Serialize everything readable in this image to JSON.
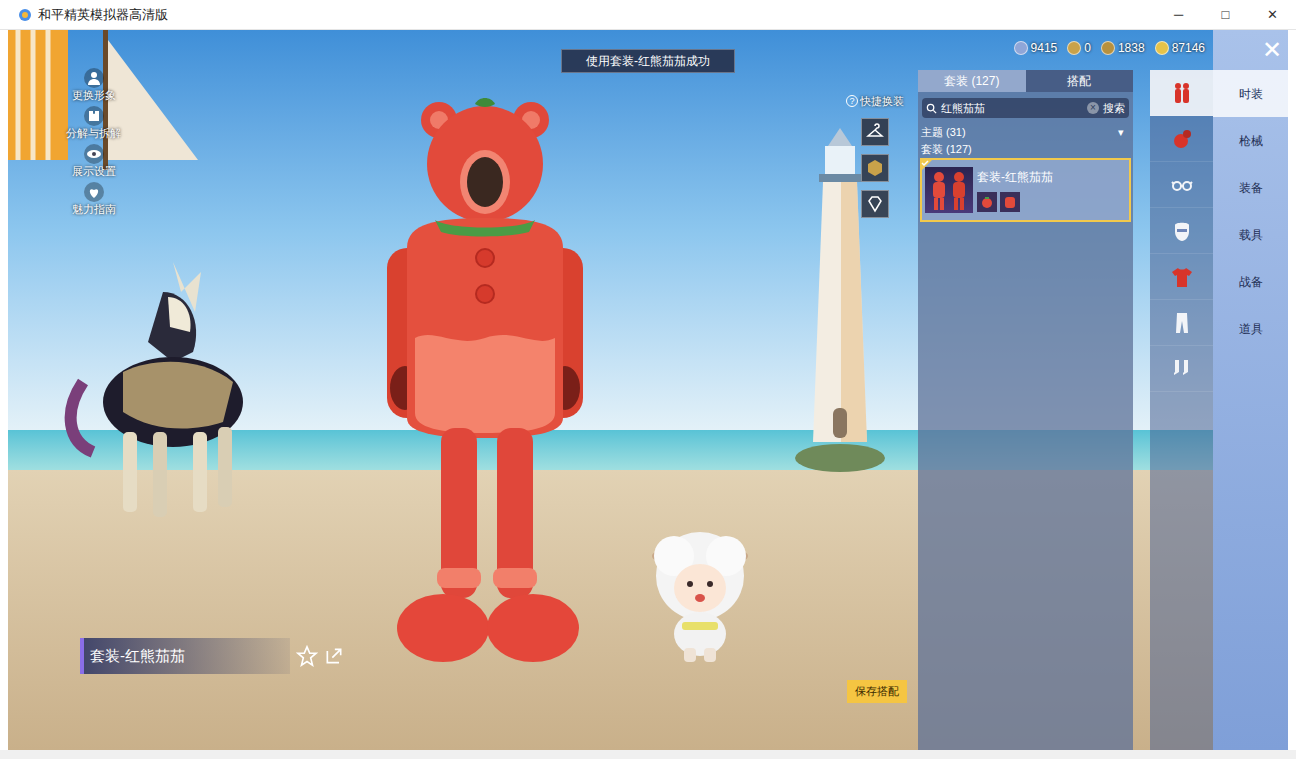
{
  "window": {
    "title": "和平精英模拟器高清版",
    "controls": [
      "─",
      "□",
      "✕"
    ]
  },
  "toast": "使用套装-红熊茄茄成功",
  "currencies": [
    {
      "value": "9415",
      "color": "#8fa6d8"
    },
    {
      "value": "0",
      "color": "#c9a24a"
    },
    {
      "value": "1838",
      "color": "#b8913e"
    },
    {
      "value": "87146",
      "color": "#e6c34a"
    }
  ],
  "close_button": "✕",
  "side_menu": [
    {
      "label": "更换形象"
    },
    {
      "label": "分解与拆解"
    },
    {
      "label": "展示设置"
    },
    {
      "label": "魅力指南"
    }
  ],
  "quick_change": {
    "label": "快捷换装",
    "help": "?"
  },
  "outfit_name": "套装-红熊茄茄",
  "save_button": "保存搭配",
  "panel": {
    "tabs": [
      {
        "label": "套装 (127)",
        "selected": true
      },
      {
        "label": "搭配",
        "selected": false
      }
    ],
    "search": {
      "value": "红熊茄茄",
      "clear": "×",
      "button": "搜索"
    },
    "filter": {
      "label": "主题 (31)",
      "arrow": "▾"
    },
    "section": "套装 (127)",
    "items": [
      {
        "name": "套装-红熊茄茄",
        "selected": true
      }
    ]
  },
  "categories": [
    {
      "selected": true
    },
    {
      "selected": false
    },
    {
      "selected": false
    },
    {
      "selected": false
    },
    {
      "selected": false
    },
    {
      "selected": false
    },
    {
      "selected": false
    }
  ],
  "nav": [
    {
      "label": "时装",
      "selected": true
    },
    {
      "label": "枪械",
      "selected": false
    },
    {
      "label": "装备",
      "selected": false
    },
    {
      "label": "载具",
      "selected": false
    },
    {
      "label": "战备",
      "selected": false
    },
    {
      "label": "道具",
      "selected": false
    }
  ]
}
